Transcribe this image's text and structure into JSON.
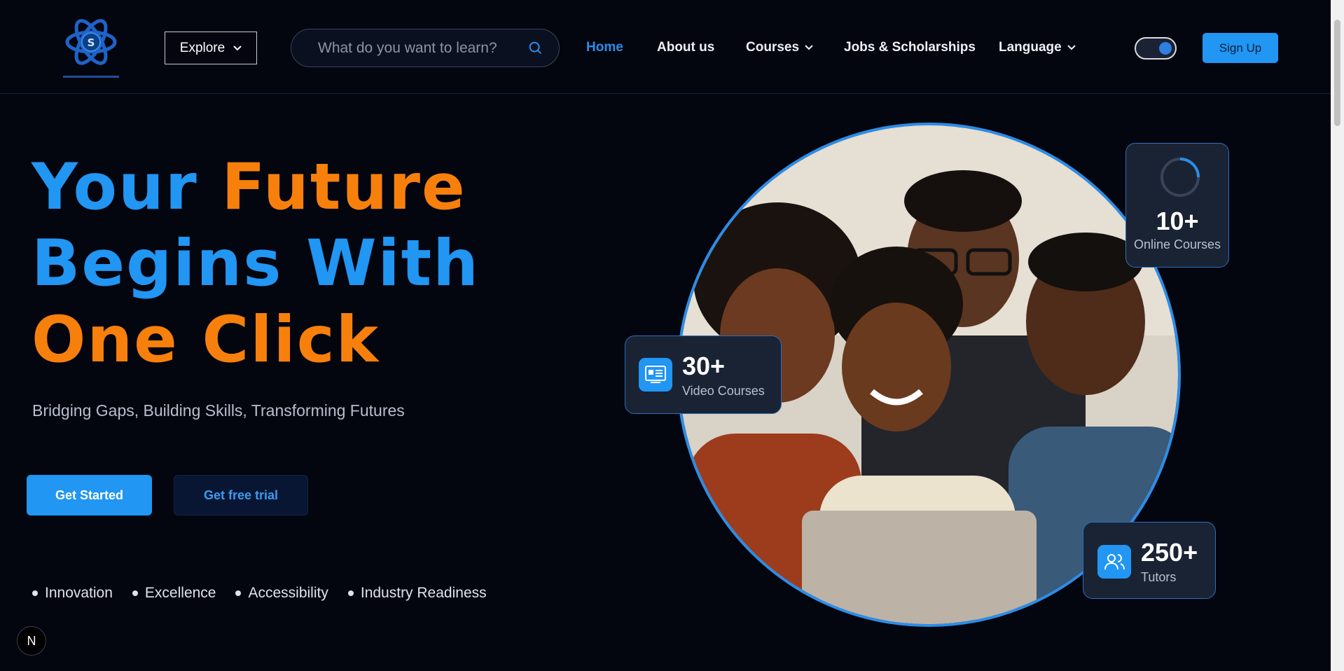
{
  "header": {
    "explore_label": "Explore",
    "search_placeholder": "What do you want to learn?",
    "nav": [
      {
        "label": "Home",
        "active": true
      },
      {
        "label": "About us",
        "active": false
      },
      {
        "label": "Courses",
        "active": false
      },
      {
        "label": "Jobs & Scholarships",
        "active": false
      },
      {
        "label": "Language",
        "active": false
      }
    ],
    "theme_toggle_on": true,
    "signup_label": "Sign Up"
  },
  "hero": {
    "headline": {
      "line1_a": "Your",
      "line1_b": "Future",
      "line2_a": "Begins",
      "line2_b": "With",
      "line3": "One Click"
    },
    "subtitle": "Bridging Gaps, Building Skills, Transforming Futures",
    "get_started_label": "Get Started",
    "free_trial_label": "Get free trial",
    "values": [
      "Innovation",
      "Excellence",
      "Accessibility",
      "Industry Readiness"
    ]
  },
  "stats": {
    "online": {
      "number": "10+",
      "label": "Online Courses",
      "icon": "progress-ring-icon"
    },
    "video": {
      "number": "30+",
      "label": "Video Courses",
      "icon": "video-course-icon"
    },
    "tutors": {
      "number": "250+",
      "label": "Tutors",
      "icon": "users-icon"
    }
  },
  "dev_badge": "N",
  "colors": {
    "background": "#03050f",
    "accent_blue": "#2196f3",
    "accent_orange": "#f7800c",
    "card": "#1a2333"
  }
}
